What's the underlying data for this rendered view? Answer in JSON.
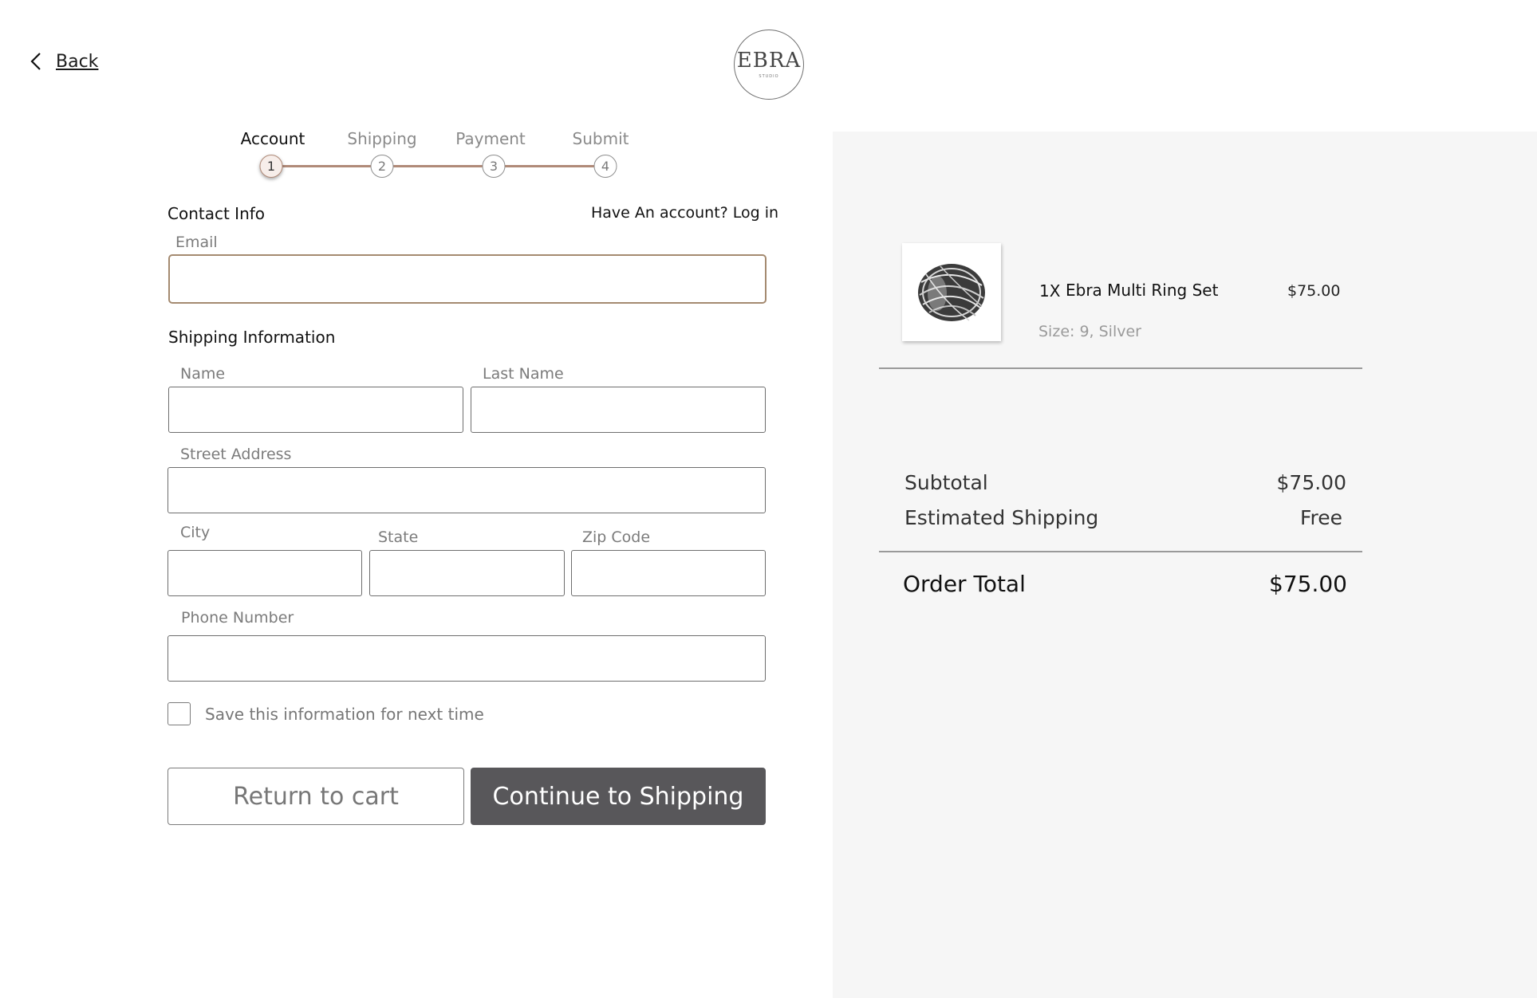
{
  "nav": {
    "back_label": "Back"
  },
  "brand": {
    "logo_text": "EBRA",
    "logo_subtext": "STUDIO"
  },
  "stepper": {
    "steps": [
      {
        "label": "Account",
        "number": "1"
      },
      {
        "label": "Shipping",
        "number": "2"
      },
      {
        "label": "Payment",
        "number": "3"
      },
      {
        "label": "Submit",
        "number": "4"
      }
    ],
    "active_step": "Account"
  },
  "contact": {
    "title": "Contact Info",
    "login_prompt": "Have An account? Log in",
    "email_label": "Email",
    "email_value": ""
  },
  "shipping": {
    "title": "Shipping Information",
    "fields": {
      "name": {
        "label": "Name",
        "value": ""
      },
      "last_name": {
        "label": "Last Name",
        "value": ""
      },
      "street": {
        "label": "Street Address",
        "value": ""
      },
      "city": {
        "label": "City",
        "value": ""
      },
      "state": {
        "label": "State",
        "value": ""
      },
      "zip": {
        "label": "Zip Code",
        "value": ""
      },
      "phone": {
        "label": "Phone Number",
        "value": ""
      }
    },
    "save_info_label": "Save this information for next time",
    "save_info_checked": false
  },
  "actions": {
    "return_label": "Return to cart",
    "continue_label": "Continue to Shipping"
  },
  "order": {
    "items": [
      {
        "quantity": "1X",
        "name": "Ebra Multi Ring Set",
        "price": "$75.00",
        "variant": "Size: 9, Silver",
        "thumbnail_icon": "ring-icon"
      }
    ],
    "subtotal_label": "Subtotal",
    "subtotal_value": "$75.00",
    "shipping_label": "Estimated Shipping",
    "shipping_value": "Free",
    "total_label": "Order Total",
    "total_value": "$75.00"
  },
  "colors": {
    "accent": "#b08a78",
    "primary_button": "#58575a",
    "panel_background": "#f6f6f6"
  }
}
